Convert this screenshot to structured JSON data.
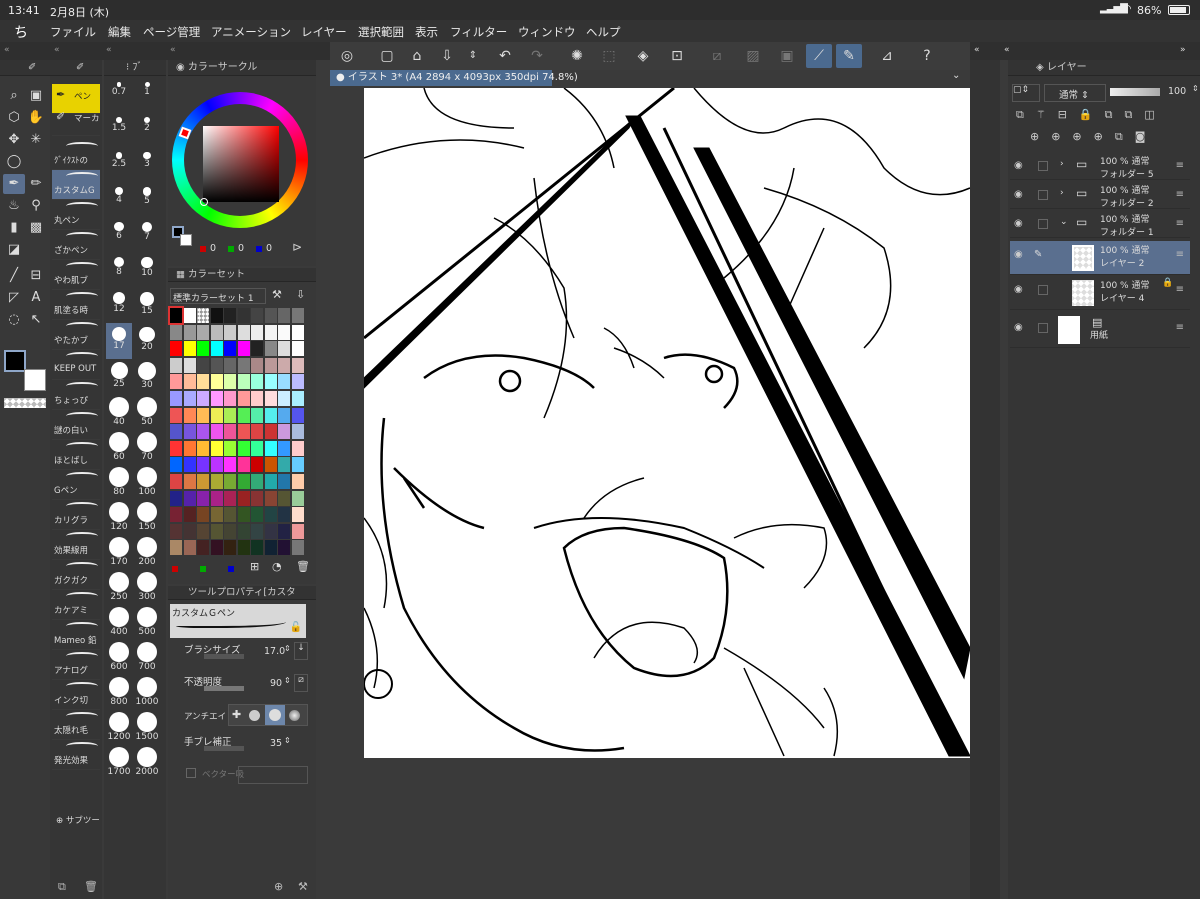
{
  "status": {
    "time": "13:41",
    "date": "2月8日 (木)",
    "battery": "86%"
  },
  "menu": [
    "ファイル",
    "編集",
    "ページ管理",
    "アニメーション",
    "レイヤー",
    "選択範囲",
    "表示",
    "フィルター",
    "ウィンドウ",
    "ヘルプ"
  ],
  "canvas": {
    "tab_title": "イラスト 3* (A4 2894 x 4093px 350dpi 74.8%)"
  },
  "subtools": [
    "ペン",
    "マーカ",
    "ｸﾞｲｸｽﾄの",
    "カスタムG",
    "丸ペン",
    "ざかペン",
    "やわ肌ブ",
    "肌塗る時",
    "やたかブ",
    "KEEP OUT",
    "ちょっぴ",
    "謎の白い",
    "ほとばし",
    "Gペン",
    "カリグラ",
    "効果線用",
    "ガクガク",
    "カケアミ",
    "Mameo 鉛",
    "アナログ",
    "インク切",
    "太隠れ毛",
    "発光効果"
  ],
  "subtool_add": "サブツー",
  "brush_sizes": [
    [
      "0.7",
      "1"
    ],
    [
      "1.5",
      "2"
    ],
    [
      "2.5",
      "3"
    ],
    [
      "4",
      "5"
    ],
    [
      "6",
      "7"
    ],
    [
      "8",
      "10"
    ],
    [
      "12",
      "15"
    ],
    [
      "17",
      "20"
    ],
    [
      "25",
      "30"
    ],
    [
      "40",
      "50"
    ],
    [
      "60",
      "70"
    ],
    [
      "80",
      "100"
    ],
    [
      "120",
      "150"
    ],
    [
      "170",
      "200"
    ],
    [
      "250",
      "300"
    ],
    [
      "400",
      "500"
    ],
    [
      "600",
      "700"
    ],
    [
      "800",
      "1000"
    ],
    [
      "1200",
      "1500"
    ],
    [
      "1700",
      "2000"
    ]
  ],
  "color_circle": {
    "title": "カラーサークル",
    "rgb": [
      "0",
      "0",
      "0"
    ]
  },
  "color_set": {
    "title": "カラーセット",
    "preset": "標準カラーセット 1"
  },
  "tool_property": {
    "title": "ツールプロパティ[カスタ",
    "tool_name": "カスタムＧペン",
    "brush_size_label": "ブラシサイズ",
    "brush_size": "17.0",
    "opacity_label": "不透明度",
    "opacity": "90",
    "aa_label": "アンチエイリ",
    "stab_label": "手ブレ補正",
    "stab": "35",
    "vector_label": "ベクター吸"
  },
  "layer_panel": {
    "title": "レイヤー",
    "blend": "通常",
    "opacity": "100",
    "layers": [
      {
        "mode": "100 % 通常",
        "name": "フォルダー 5",
        "type": "folder"
      },
      {
        "mode": "100 % 通常",
        "name": "フォルダー 2",
        "type": "folder"
      },
      {
        "mode": "100 % 通常",
        "name": "フォルダー 1",
        "type": "folder-open"
      },
      {
        "mode": "100 % 通常",
        "name": "レイヤー 2",
        "type": "raster",
        "selected": true
      },
      {
        "mode": "100 % 通常",
        "name": "レイヤー 4",
        "type": "raster"
      },
      {
        "mode": "",
        "name": "用紙",
        "type": "paper"
      }
    ]
  }
}
